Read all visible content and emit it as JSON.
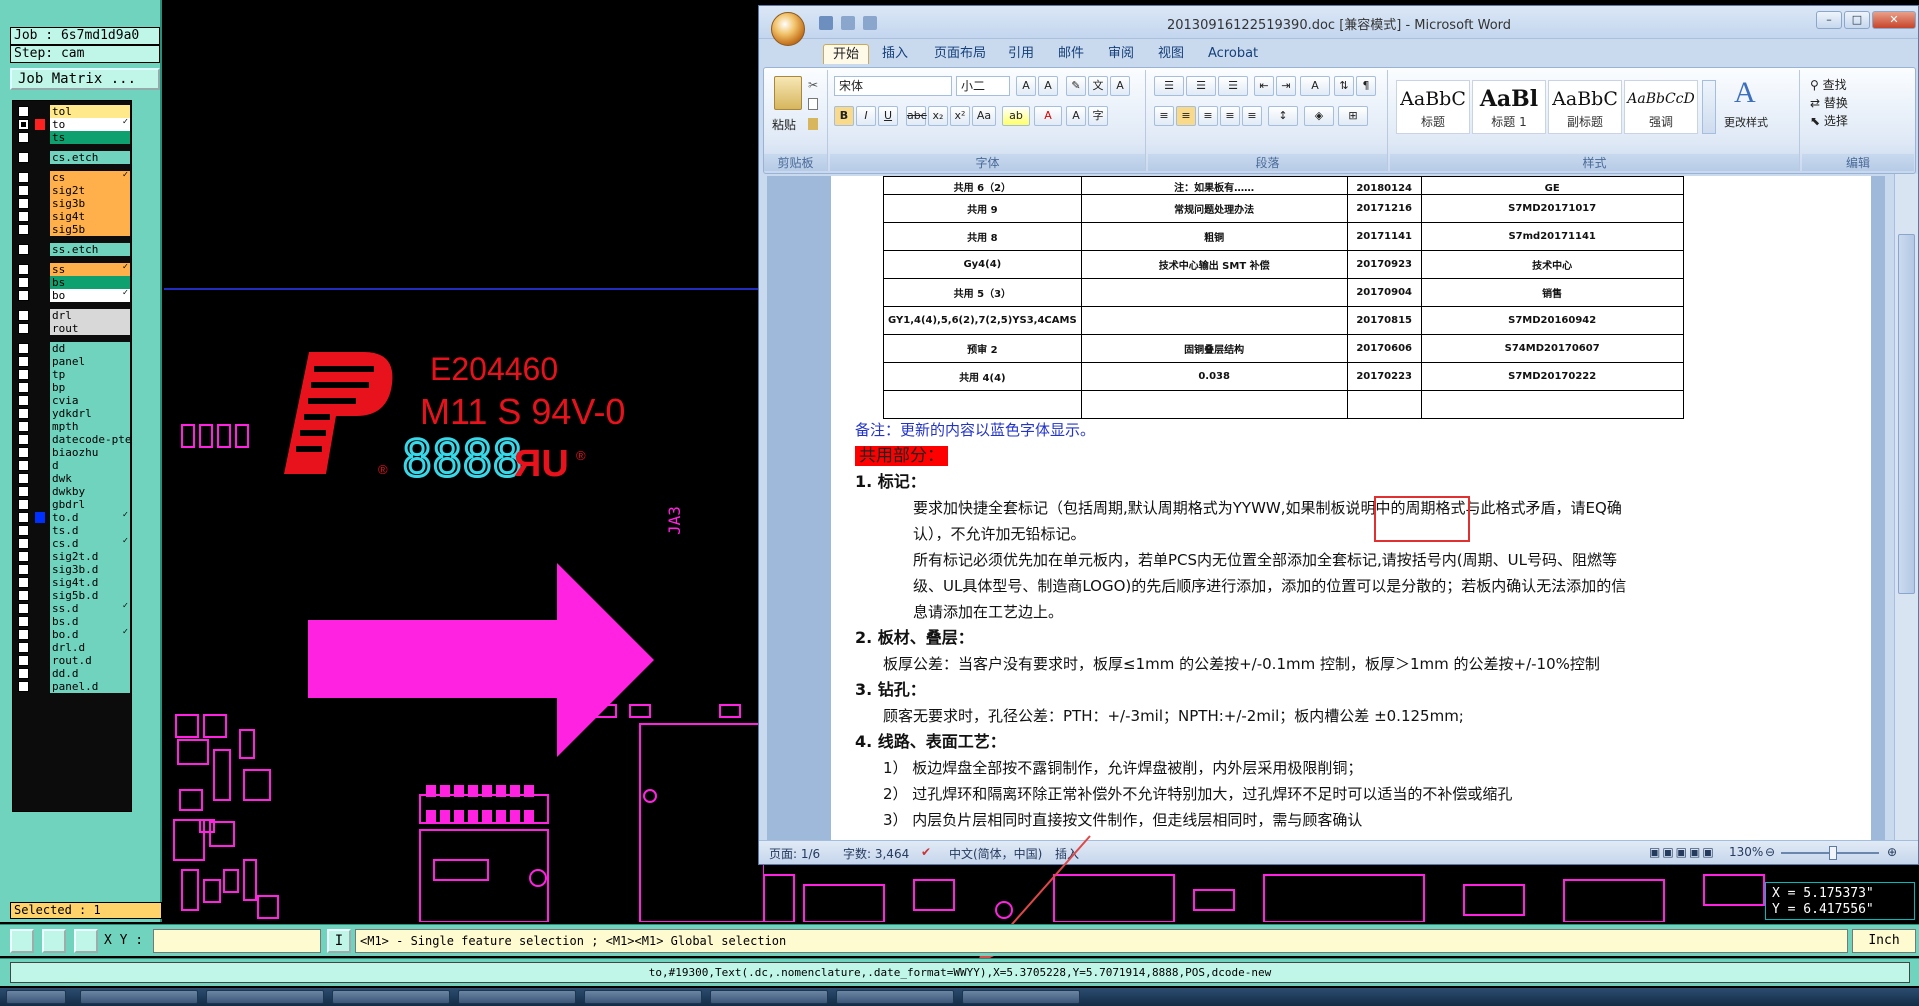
{
  "left_panel": {
    "job_label": "Job : 6s7md1d9a0",
    "step_label": "Step: cam",
    "job_matrix_button": "Job Matrix ...",
    "layers": [
      {
        "name": "tol",
        "color": "#ffe98a",
        "sep": false
      },
      {
        "name": "to",
        "color": "#ffffff",
        "sep": false,
        "active": true,
        "flag": "✓"
      },
      {
        "name": "ts",
        "color": "#0fa070",
        "sep": false
      },
      {
        "name": "cs.etch",
        "color": "#6fd3bd",
        "sep": true
      },
      {
        "name": "cs",
        "color": "#ffb04a",
        "sep": true,
        "flag": "✓"
      },
      {
        "name": "sig2t",
        "color": "#ffb04a",
        "sep": false
      },
      {
        "name": "sig3b",
        "color": "#ffb04a",
        "sep": false
      },
      {
        "name": "sig4t",
        "color": "#ffb04a",
        "sep": false
      },
      {
        "name": "sig5b",
        "color": "#ffb04a",
        "sep": false
      },
      {
        "name": "ss.etch",
        "color": "#6fd3bd",
        "sep": true
      },
      {
        "name": "ss",
        "color": "#ffb04a",
        "sep": true,
        "flag": "✓"
      },
      {
        "name": "bs",
        "color": "#0fa070",
        "sep": false
      },
      {
        "name": "bo",
        "color": "#ffffff",
        "sep": false,
        "flag": "✓"
      },
      {
        "name": "drl",
        "color": "#d8d8d8",
        "sep": true
      },
      {
        "name": "rout",
        "color": "#d8d8d8",
        "sep": false
      },
      {
        "name": "dd",
        "color": "#6fd3bd",
        "sep": true
      },
      {
        "name": "panel",
        "color": "#6fd3bd",
        "sep": false
      },
      {
        "name": "tp",
        "color": "#6fd3bd",
        "sep": false
      },
      {
        "name": "bp",
        "color": "#6fd3bd",
        "sep": false
      },
      {
        "name": "cvia",
        "color": "#6fd3bd",
        "sep": false
      },
      {
        "name": "ydkdrl",
        "color": "#6fd3bd",
        "sep": false
      },
      {
        "name": "mpth",
        "color": "#6fd3bd",
        "sep": false
      },
      {
        "name": "datecode-pte",
        "color": "#6fd3bd",
        "sep": false
      },
      {
        "name": "biaozhu",
        "color": "#6fd3bd",
        "sep": false
      },
      {
        "name": "d",
        "color": "#6fd3bd",
        "sep": false
      },
      {
        "name": "dwk",
        "color": "#6fd3bd",
        "sep": false
      },
      {
        "name": "dwkby",
        "color": "#6fd3bd",
        "sep": false
      },
      {
        "name": "gbdrl",
        "color": "#6fd3bd",
        "sep": false
      },
      {
        "name": "to.d",
        "color": "#6fd3bd",
        "sep": false,
        "swatch": "#0030ff",
        "flag": "✓"
      },
      {
        "name": "ts.d",
        "color": "#6fd3bd",
        "sep": false
      },
      {
        "name": "cs.d",
        "color": "#6fd3bd",
        "sep": false,
        "flag": "✓"
      },
      {
        "name": "sig2t.d",
        "color": "#6fd3bd",
        "sep": false
      },
      {
        "name": "sig3b.d",
        "color": "#6fd3bd",
        "sep": false
      },
      {
        "name": "sig4t.d",
        "color": "#6fd3bd",
        "sep": false
      },
      {
        "name": "sig5b.d",
        "color": "#6fd3bd",
        "sep": false
      },
      {
        "name": "ss.d",
        "color": "#6fd3bd",
        "sep": false,
        "flag": "✓"
      },
      {
        "name": "bs.d",
        "color": "#6fd3bd",
        "sep": false
      },
      {
        "name": "bo.d",
        "color": "#6fd3bd",
        "sep": false,
        "flag": "✓"
      },
      {
        "name": "drl.d",
        "color": "#6fd3bd",
        "sep": false
      },
      {
        "name": "rout.d",
        "color": "#6fd3bd",
        "sep": false
      },
      {
        "name": "dd.d",
        "color": "#6fd3bd",
        "sep": false
      },
      {
        "name": "panel.d",
        "color": "#6fd3bd",
        "sep": false
      }
    ],
    "selected_label": "Selected : 1"
  },
  "canvas": {
    "text_e": "E204460",
    "text_m11": "M11 S 94V-0",
    "text_digits": "8888",
    "text_ja3": "JA3",
    "colors": {
      "red": "#e8121c",
      "magenta": "#ff22e0",
      "cyan": "#38d8e8",
      "blue": "#2a3cff"
    }
  },
  "coords": {
    "x": "X = 5.175373\"",
    "y": "Y = 6.417556\""
  },
  "cmdbar": {
    "xy_label": "X Y :",
    "xy_value": "",
    "hint": "<M1> - Single feature selection ; <M1><M1> Global selection",
    "unit": "Inch"
  },
  "status_line": "to,#19300,Text(.dc,.nomenclature,.date_format=WWYY),X=5.3705228,Y=5.7071914,8888,POS,dcode-new",
  "word": {
    "title": "20130916122519390.doc [兼容模式] - Microsoft Word",
    "tabs": [
      "开始",
      "插入",
      "页面布局",
      "引用",
      "邮件",
      "审阅",
      "视图",
      "Acrobat"
    ],
    "ribbon": {
      "paste": "粘贴",
      "clipboard": "剪贴板",
      "font_name": "宋体",
      "font_size": "小二",
      "font_group": "字体",
      "para_group": "段落",
      "styles_group": "样式",
      "edit_group": "编辑",
      "styles": [
        {
          "sample": "AaBbC",
          "name": "标题"
        },
        {
          "sample": "AaBl",
          "name": "标题 1"
        },
        {
          "sample": "AaBbC",
          "name": "副标题"
        },
        {
          "sample": "AaBbCcD",
          "name": "强调"
        }
      ],
      "change_styles": "更改样式",
      "find": "查找",
      "replace": "替换",
      "select": "选择"
    },
    "table": [
      [
        "共用 6（2）",
        "注：如果板有……",
        "20180124",
        "GE"
      ],
      [
        "共用 9",
        "常规问题处理办法",
        "20171216",
        "S7MD20171017"
      ],
      [
        "共用 8",
        "粗铜",
        "20171141",
        "S7md20171141"
      ],
      [
        "Gy4(4)",
        "技术中心输出 SMT 补偿",
        "20170923",
        "技术中心"
      ],
      [
        "共用 5（3）",
        "",
        "20170904",
        "销售"
      ],
      [
        "GY1,4(4),5,6(2),7(2,5)YS3,4CAMS",
        "",
        "20170815",
        "S7MD20160942"
      ],
      [
        "预审 2",
        "固铜叠层结构",
        "20170606",
        "S74MD20170607"
      ],
      [
        "共用 4(4)",
        "0.038",
        "20170223",
        "S7MD20170222"
      ],
      [
        "",
        "",
        "",
        ""
      ]
    ],
    "note": "备注：更新的内容以蓝色字体显示。",
    "heading": "共用部分：",
    "s1": "1.   标记：",
    "p1a": "要求加快捷全套标记（包括周期,默认周期格式为YYWW,如果制板说明中的周期格式与此格式矛盾，请EQ确",
    "p1b": "认），不允许加无铅标记。",
    "p1c": "所有标记必须优先加在单元板内，若单PCS内无位置全部添加全套标记,请按括号内(周期、UL号码、阻燃等",
    "p1d": "级、UL具体型号、制造商LOGO)的先后顺序进行添加，添加的位置可以是分散的；若板内确认无法添加的信",
    "p1e": "息请添加在工艺边上。",
    "s2": "2.   板材、叠层：",
    "p2": "板厚公差：当客户没有要求时，板厚≤1mm 的公差按+/-0.1mm 控制，板厚＞1mm 的公差按+/-10%控制",
    "s3": "3.   钻孔：",
    "p3": "顾客无要求时，孔径公差：PTH：+/-3mil；NPTH:+/-2mil；板内槽公差   ±0.125mm;",
    "s4": "4.   线路、表面工艺：",
    "p4a": "1）  板边焊盘全部按不露铜制作，允许焊盘被削，内外层采用极限削铜；",
    "p4b": "2）  过孔焊环和隔离环除正常补偿外不允许特别加大，过孔焊环不足时可以适当的不补偿或缩孔",
    "p4c": "3）  内层负片层相同时直接按文件制作，但走线层相同时，需与顾客确认",
    "statusbar": {
      "page": "页面: 1/6",
      "words": "字数: 3,464",
      "lang": "中文(简体，中国)",
      "mode": "插入",
      "zoom": "130%"
    }
  }
}
